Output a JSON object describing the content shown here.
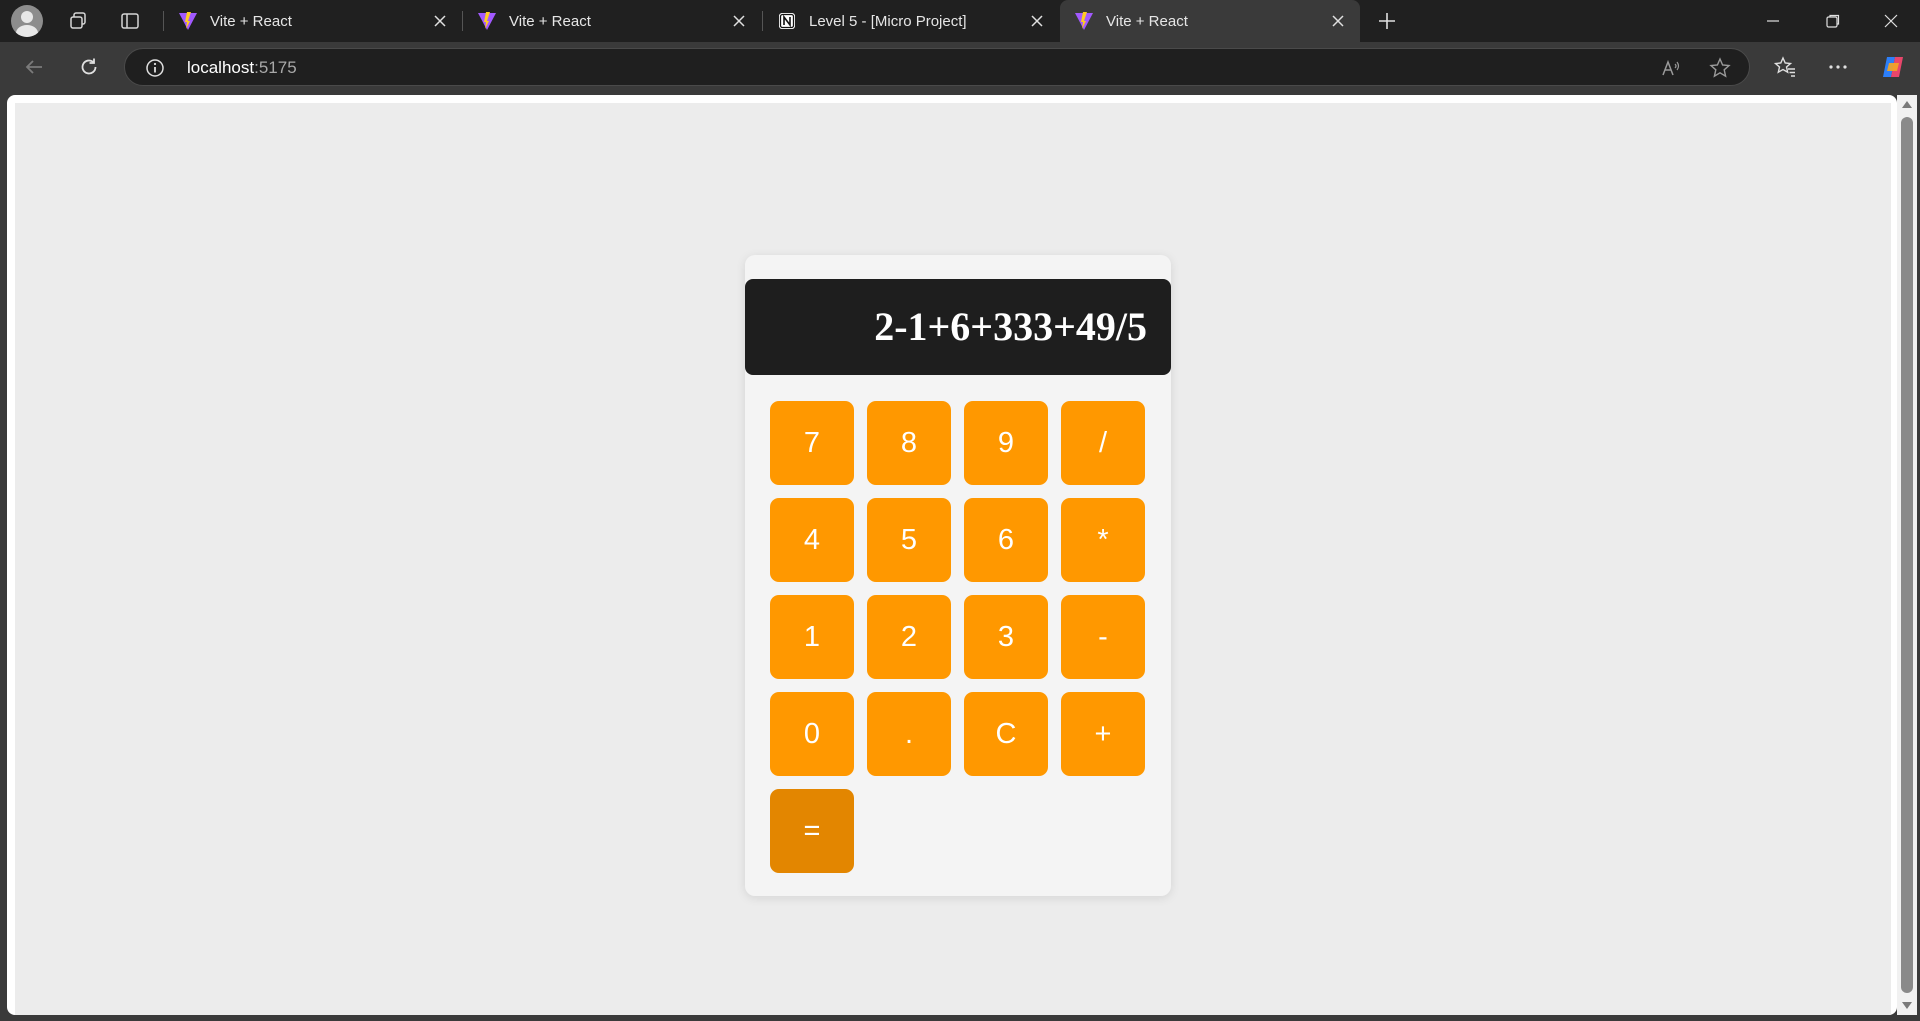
{
  "browser": {
    "tabs": [
      {
        "title": "Vite + React",
        "favicon": "vite-icon",
        "active": false
      },
      {
        "title": "Vite + React",
        "favicon": "vite-icon",
        "active": false
      },
      {
        "title": "Level 5 - [Micro Project]",
        "favicon": "notion-icon",
        "active": false
      },
      {
        "title": "Vite + React",
        "favicon": "vite-icon",
        "active": true
      }
    ],
    "address": {
      "host": "localhost",
      "port": ":5175"
    }
  },
  "calculator": {
    "display": "2-1+6+333+49/5",
    "keys": [
      "7",
      "8",
      "9",
      "/",
      "4",
      "5",
      "6",
      "*",
      "1",
      "2",
      "3",
      "-",
      "0",
      ".",
      "C",
      "+",
      "="
    ],
    "colors": {
      "key": "#ff9800",
      "equals": "#e38600",
      "display_bg": "#1e1e1e"
    }
  }
}
